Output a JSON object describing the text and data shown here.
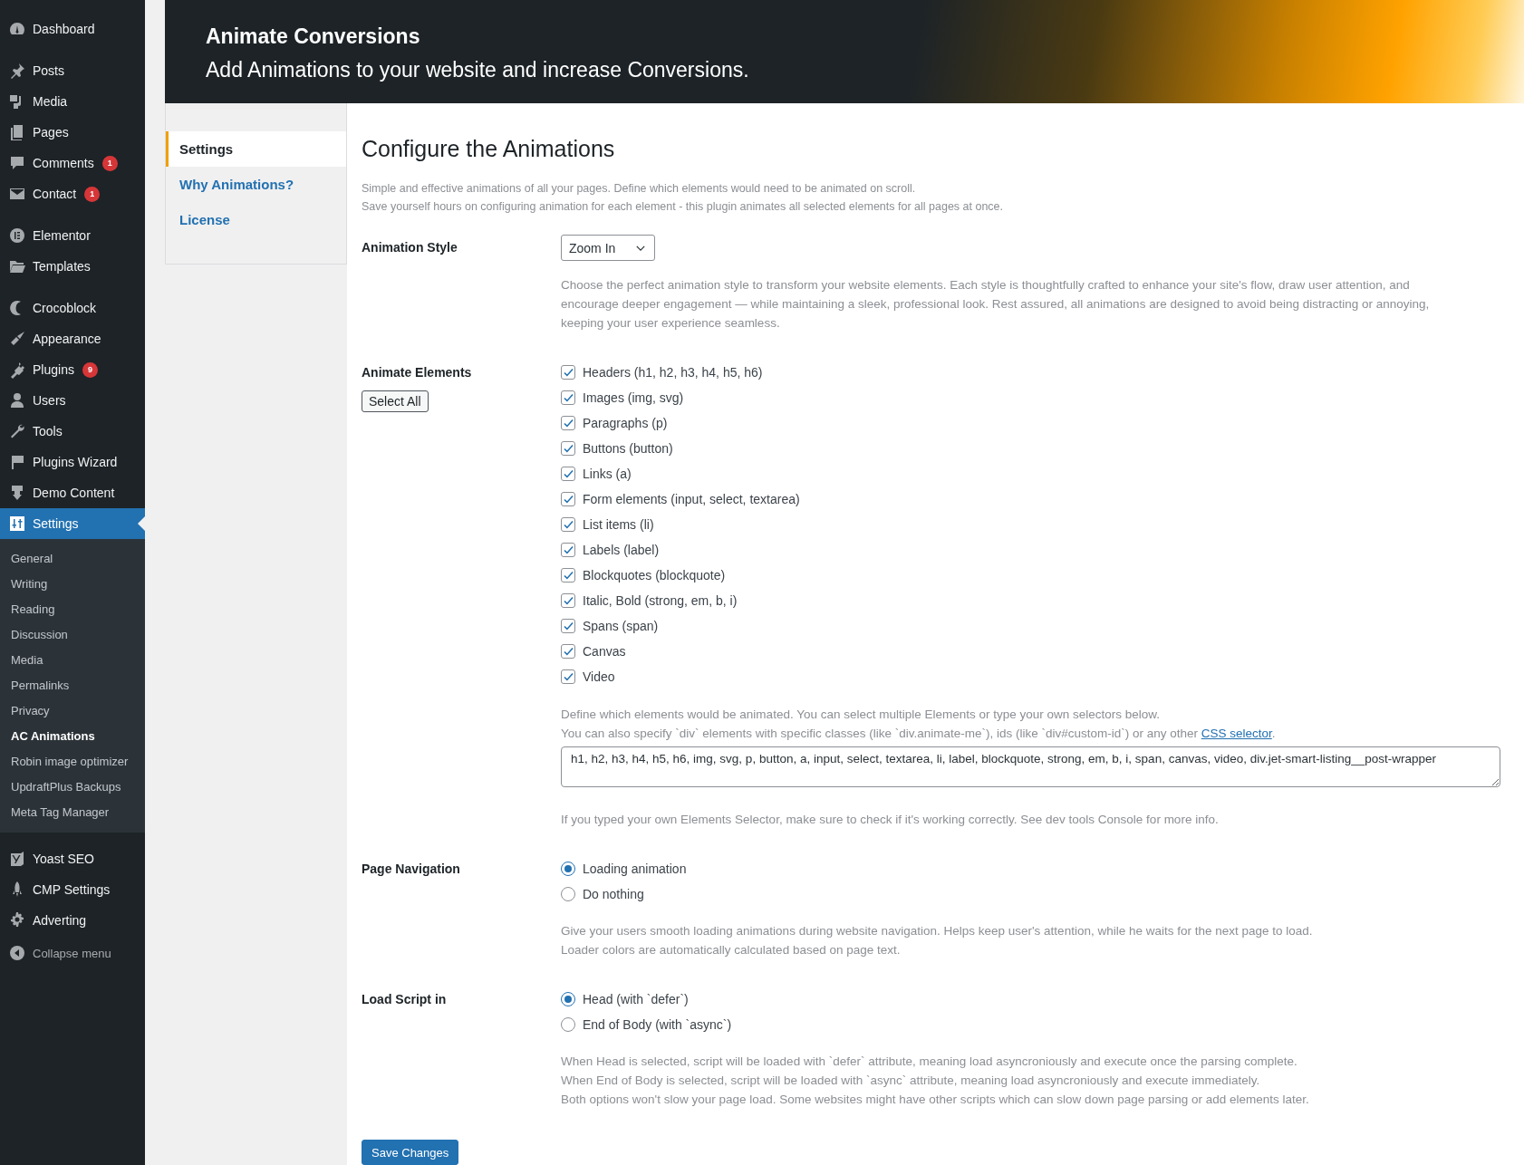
{
  "sidebar": {
    "groups": [
      {
        "items": [
          {
            "label": "Dashboard",
            "selected": false
          }
        ]
      },
      {
        "items": [
          {
            "label": "Posts",
            "selected": false
          },
          {
            "label": "Media",
            "selected": false
          },
          {
            "label": "Pages",
            "selected": false
          },
          {
            "label": "Comments",
            "badge": "1",
            "selected": false
          },
          {
            "label": "Contact",
            "badge": "1",
            "selected": false
          }
        ]
      },
      {
        "items": [
          {
            "label": "Elementor",
            "selected": false
          },
          {
            "label": "Templates",
            "selected": false
          }
        ]
      },
      {
        "items": [
          {
            "label": "Crocoblock",
            "selected": false
          },
          {
            "label": "Appearance",
            "selected": false
          },
          {
            "label": "Plugins",
            "badge": "9",
            "selected": false
          },
          {
            "label": "Users",
            "selected": false
          },
          {
            "label": "Tools",
            "selected": false
          },
          {
            "label": "Plugins Wizard",
            "selected": false
          },
          {
            "label": "Demo Content",
            "selected": false
          },
          {
            "label": "Settings",
            "selected": true,
            "children": [
              {
                "label": "General",
                "selected": false
              },
              {
                "label": "Writing",
                "selected": false
              },
              {
                "label": "Reading",
                "selected": false
              },
              {
                "label": "Discussion",
                "selected": false
              },
              {
                "label": "Media",
                "selected": false
              },
              {
                "label": "Permalinks",
                "selected": false
              },
              {
                "label": "Privacy",
                "selected": false
              },
              {
                "label": "AC Animations",
                "selected": true
              },
              {
                "label": "Robin image optimizer",
                "selected": false
              },
              {
                "label": "UpdraftPlus Backups",
                "selected": false
              },
              {
                "label": "Meta Tag Manager",
                "selected": false
              }
            ]
          }
        ]
      },
      {
        "items": [
          {
            "label": "Yoast SEO",
            "selected": false
          },
          {
            "label": "CMP Settings",
            "selected": false
          },
          {
            "label": "Adverting",
            "selected": false
          }
        ]
      }
    ],
    "collapse": "Collapse menu"
  },
  "header": {
    "title": "Animate Conversions",
    "subtitle": "Add Animations to your website and increase Conversions."
  },
  "tabs": [
    {
      "label": "Settings",
      "selected": true
    },
    {
      "label": "Why Animations?",
      "selected": false
    },
    {
      "label": "License",
      "selected": false
    }
  ],
  "form": {
    "title": "Configure the Animations",
    "description": [
      "Simple and effective animations of all your pages. Define which elements would need to be animated on scroll.",
      "Save yourself hours on configuring animation for each element - this plugin animates all selected elements for all pages at once."
    ],
    "sections": [
      {
        "kind": "select",
        "label": "Animation Style",
        "value": "Zoom In",
        "help": [
          "Choose the perfect animation style to transform your website elements. Each style is thoughtfully crafted to enhance your site's flow, draw user attention, and encourage deeper engagement — while maintaining a sleek, professional look. Rest assured, all animations are designed to avoid being distracting or annoying, keeping your user experience seamless."
        ]
      },
      {
        "kind": "checkboxes",
        "label": "Animate Elements",
        "button": "Select All",
        "options": [
          {
            "label": "Headers (h1, h2, h3, h4, h5, h6)",
            "checked": true
          },
          {
            "label": "Images (img, svg)",
            "checked": true
          },
          {
            "label": "Paragraphs (p)",
            "checked": true
          },
          {
            "label": "Buttons (button)",
            "checked": true
          },
          {
            "label": "Links (a)",
            "checked": true
          },
          {
            "label": "Form elements (input, select, textarea)",
            "checked": true
          },
          {
            "label": "List items (li)",
            "checked": true
          },
          {
            "label": "Labels (label)",
            "checked": true
          },
          {
            "label": "Blockquotes (blockquote)",
            "checked": true
          },
          {
            "label": "Italic, Bold (strong, em, b, i)",
            "checked": true
          },
          {
            "label": "Spans (span)",
            "checked": true
          },
          {
            "label": "Canvas",
            "checked": true
          },
          {
            "label": "Video",
            "checked": true
          }
        ],
        "help": [
          "Define which elements would be animated. You can select multiple Elements or type your own selectors below.",
          {
            "text": "You can also specify `div` elements with specific classes (like `div.animate-me`), ids (like `div#custom-id`) or any other ",
            "link": "CSS selector",
            "after": "."
          }
        ],
        "selectors": "h1, h2, h3, h4, h5, h6, img, svg, p, button, a, input, select, textarea, li, label, blockquote, strong, em, b, i, span, canvas, video, div.jet-smart-listing__post-wrapper",
        "note": "If you typed your own Elements Selector, make sure to check if it's working correctly. See dev tools Console for more info."
      },
      {
        "kind": "radios",
        "label": "Page Navigation",
        "options": [
          {
            "label": "Loading animation",
            "selected": true
          },
          {
            "label": "Do nothing",
            "selected": false
          }
        ],
        "help": [
          "Give your users smooth loading animations during website navigation. Helps keep user's attention, while he waits for the next page to load.",
          "Loader colors are automatically calculated based on page text."
        ]
      },
      {
        "kind": "radios",
        "label": "Load Script in",
        "options": [
          {
            "label": "Head (with `defer`)",
            "selected": true
          },
          {
            "label": "End of Body (with `async`)",
            "selected": false
          }
        ],
        "help": [
          "When Head is selected, script will be loaded with `defer` attribute, meaning load asyncroniously and execute once the parsing complete.",
          "When End of Body is selected, script will be loaded with `async` attribute, meaning load asyncroniously and execute immediately.",
          "Both options won't slow your page load. Some websites might have other scripts which can slow down page parsing or add elements later."
        ]
      }
    ],
    "save": "Save Changes"
  }
}
